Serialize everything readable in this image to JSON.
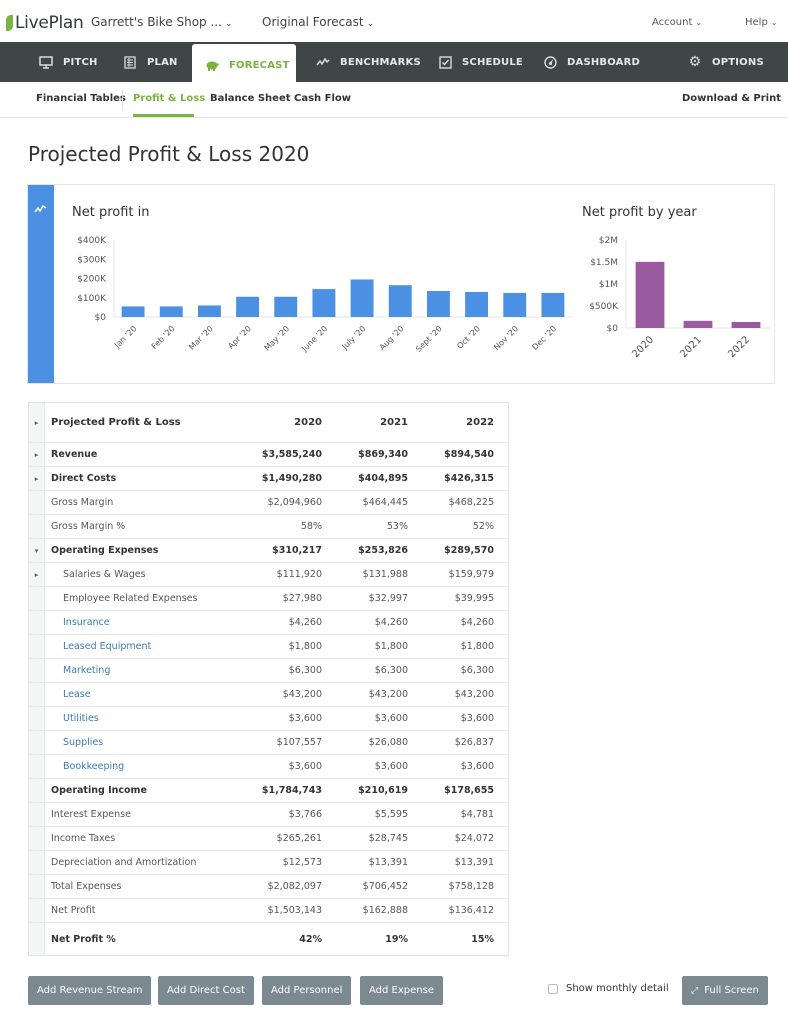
{
  "app": {
    "logo": "LivePlan",
    "business_selector": "Garrett's Bike Shop ...",
    "forecast_selector": "Original Forecast",
    "account_menu": "Account",
    "help_menu": "Help"
  },
  "nav": {
    "tabs": [
      {
        "label": "PITCH",
        "icon": "monitor-icon",
        "active": false
      },
      {
        "label": "PLAN",
        "icon": "document-icon",
        "active": false
      },
      {
        "label": "FORECAST",
        "icon": "piggy-bank-icon",
        "active": true
      },
      {
        "label": "BENCHMARKS",
        "icon": "trend-line-icon",
        "active": false
      },
      {
        "label": "SCHEDULE",
        "icon": "checkbox-calendar-icon",
        "active": false
      },
      {
        "label": "DASHBOARD",
        "icon": "gauge-icon",
        "active": false
      },
      {
        "label": "OPTIONS",
        "icon": "gear-icon",
        "active": false
      }
    ]
  },
  "subnav": {
    "items": [
      {
        "label": "Financial Tables",
        "active": false
      },
      {
        "label": "Profit & Loss",
        "active": true
      },
      {
        "label": "Balance Sheet",
        "active": false
      },
      {
        "label": "Cash Flow",
        "active": false
      }
    ],
    "download": "Download & Print"
  },
  "page": {
    "title": "Projected Profit & Loss 2020"
  },
  "colors": {
    "brand_green": "#7ab33f",
    "monthly_bar": "#4b90e2",
    "yearly_bar": "#9b5aa0",
    "nav_bg": "#3e4648",
    "link_blue": "#3d7ab3",
    "button_gray": "#7b8a90"
  },
  "chart_data": [
    {
      "type": "bar",
      "title": "Net profit in",
      "xlabel": "",
      "ylabel": "",
      "categories": [
        "Jan '20",
        "Feb '20",
        "Mar '20",
        "Apr '20",
        "May '20",
        "June '20",
        "July '20",
        "Aug '20",
        "Sept '20",
        "Oct '20",
        "Nov '20",
        "Dec '20"
      ],
      "values": [
        55000,
        55000,
        60000,
        105000,
        105000,
        145000,
        195000,
        165000,
        135000,
        130000,
        125000,
        125000
      ],
      "yticks": [
        "$0",
        "$100K",
        "$200K",
        "$300K",
        "$400K"
      ],
      "ylim": [
        0,
        400000
      ],
      "color": "#4b90e2",
      "grid": false
    },
    {
      "type": "bar",
      "title": "Net profit by year",
      "xlabel": "",
      "ylabel": "",
      "categories": [
        "2020",
        "2021",
        "2022"
      ],
      "values": [
        1503143,
        162888,
        136412
      ],
      "yticks": [
        "$0",
        "$500K",
        "$1M",
        "$1.5M",
        "$2M"
      ],
      "ylim": [
        0,
        2000000
      ],
      "color": "#9b5aa0",
      "grid": false
    }
  ],
  "table": {
    "header": {
      "label": "Projected Profit & Loss",
      "cols": [
        "2020",
        "2021",
        "2022"
      ],
      "toggle": "expand"
    },
    "rows": [
      {
        "label": "Revenue",
        "values": [
          "$3,585,240",
          "$869,340",
          "$894,540"
        ],
        "style": "bold",
        "toggle": "expand"
      },
      {
        "label": "Direct Costs",
        "values": [
          "$1,490,280",
          "$404,895",
          "$426,315"
        ],
        "style": "bold",
        "toggle": "expand"
      },
      {
        "label": "Gross Margin",
        "values": [
          "$2,094,960",
          "$464,445",
          "$468,225"
        ],
        "style": "normal",
        "toggle": ""
      },
      {
        "label": "Gross Margin %",
        "values": [
          "58%",
          "53%",
          "52%"
        ],
        "style": "normal",
        "toggle": ""
      },
      {
        "label": "Operating Expenses",
        "values": [
          "$310,217",
          "$253,826",
          "$289,570"
        ],
        "style": "bold",
        "toggle": "collapse"
      },
      {
        "label": "Salaries & Wages",
        "values": [
          "$111,920",
          "$131,988",
          "$159,979"
        ],
        "style": "indent",
        "toggle": "expand"
      },
      {
        "label": "Employee Related Expenses",
        "values": [
          "$27,980",
          "$32,997",
          "$39,995"
        ],
        "style": "indent",
        "toggle": ""
      },
      {
        "label": "Insurance",
        "values": [
          "$4,260",
          "$4,260",
          "$4,260"
        ],
        "style": "link",
        "toggle": ""
      },
      {
        "label": "Leased Equipment",
        "values": [
          "$1,800",
          "$1,800",
          "$1,800"
        ],
        "style": "link",
        "toggle": ""
      },
      {
        "label": "Marketing",
        "values": [
          "$6,300",
          "$6,300",
          "$6,300"
        ],
        "style": "link",
        "toggle": ""
      },
      {
        "label": "Lease",
        "values": [
          "$43,200",
          "$43,200",
          "$43,200"
        ],
        "style": "link",
        "toggle": ""
      },
      {
        "label": "Utilities",
        "values": [
          "$3,600",
          "$3,600",
          "$3,600"
        ],
        "style": "link",
        "toggle": ""
      },
      {
        "label": "Supplies",
        "values": [
          "$107,557",
          "$26,080",
          "$26,837"
        ],
        "style": "link",
        "toggle": ""
      },
      {
        "label": "Bookkeeping",
        "values": [
          "$3,600",
          "$3,600",
          "$3,600"
        ],
        "style": "link",
        "toggle": ""
      },
      {
        "label": "Operating Income",
        "values": [
          "$1,784,743",
          "$210,619",
          "$178,655"
        ],
        "style": "bold",
        "toggle": ""
      },
      {
        "label": "Interest Expense",
        "values": [
          "$3,766",
          "$5,595",
          "$4,781"
        ],
        "style": "normal",
        "toggle": ""
      },
      {
        "label": "Income Taxes",
        "values": [
          "$265,261",
          "$28,745",
          "$24,072"
        ],
        "style": "normal",
        "toggle": ""
      },
      {
        "label": "Depreciation and Amortization",
        "values": [
          "$12,573",
          "$13,391",
          "$13,391"
        ],
        "style": "normal",
        "toggle": ""
      },
      {
        "label": "Total Expenses",
        "values": [
          "$2,082,097",
          "$706,452",
          "$758,128"
        ],
        "style": "normal",
        "toggle": ""
      },
      {
        "label": "Net Profit",
        "values": [
          "$1,503,143",
          "$162,888",
          "$136,412"
        ],
        "style": "normal",
        "toggle": ""
      },
      {
        "label": "Net Profit %",
        "values": [
          "42%",
          "19%",
          "15%"
        ],
        "style": "bold-last",
        "toggle": ""
      }
    ]
  },
  "footer": {
    "buttons": [
      "Add Revenue Stream",
      "Add Direct Cost",
      "Add Personnel",
      "Add Expense"
    ],
    "show_monthly_label": "Show monthly detail",
    "show_monthly_checked": false,
    "full_screen": "Full Screen"
  }
}
